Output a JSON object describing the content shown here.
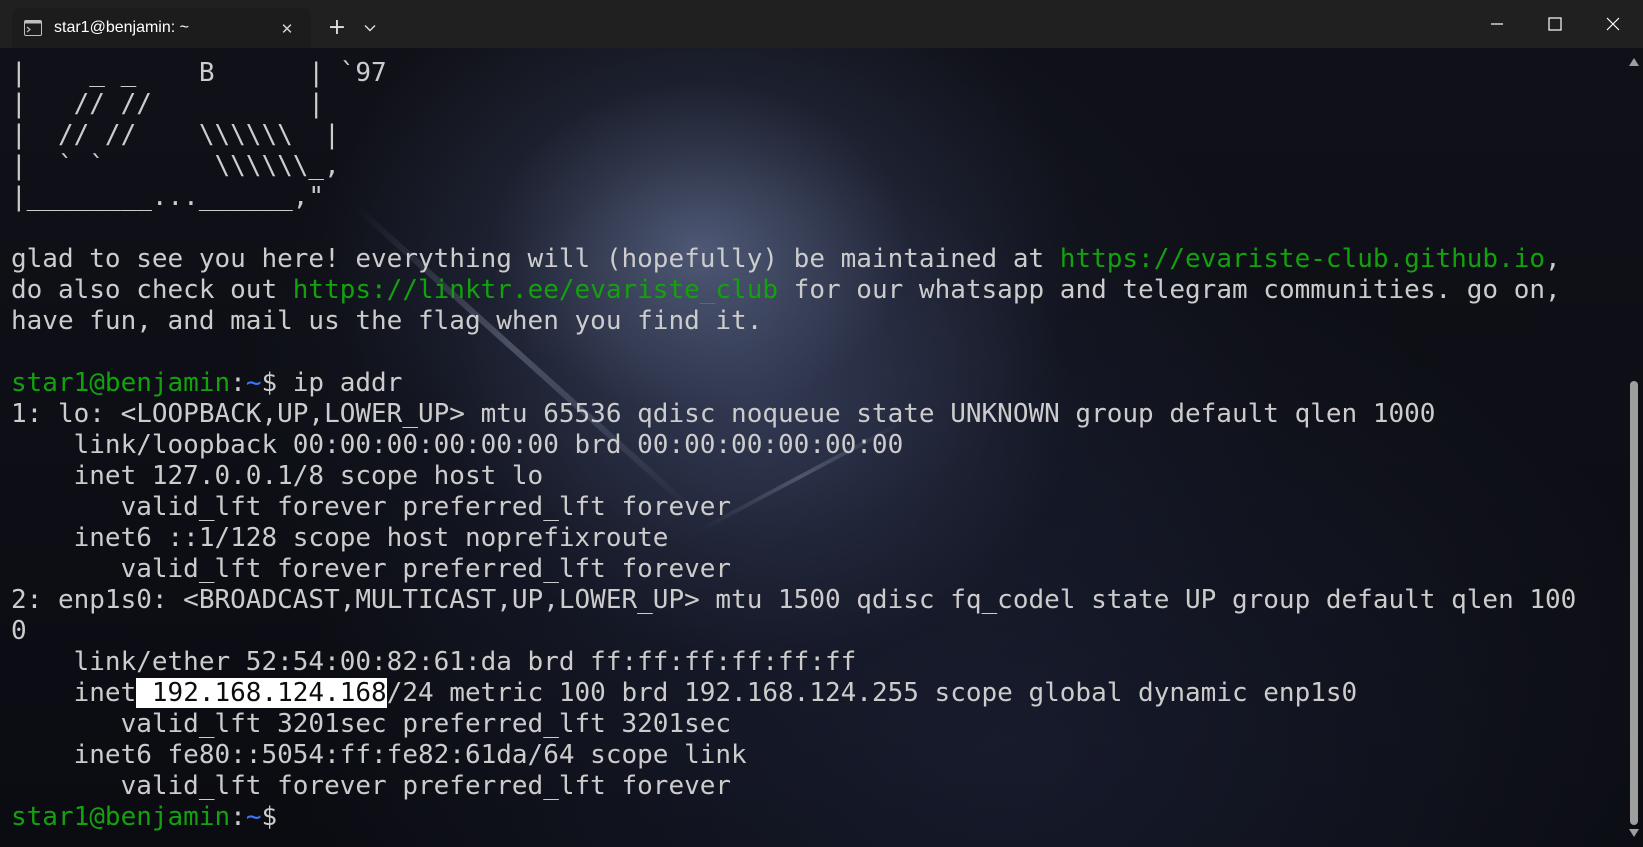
{
  "colors": {
    "prompt_user": "#13a10e",
    "prompt_path": "#3b78ff",
    "text": "#cccccc",
    "link": "#13a10e",
    "selection_bg": "#ffffff",
    "titlebar_bg": "#202020",
    "terminal_bg": "#0c0c0c"
  },
  "icons": {
    "tab": "terminal-icon",
    "close_tab": "close-icon",
    "new_tab": "plus-icon",
    "tab_menu": "chevron-down-icon",
    "minimize": "minimize-icon",
    "maximize": "maximize-icon",
    "close_window": "close-window-icon"
  },
  "tab": {
    "title": "star1@benjamin: ~",
    "close_glyph": "✕",
    "new_tab_glyph": "+"
  },
  "terminal": {
    "ascii_art": [
      "|    _ _    B      | `97",
      "|   // //          |",
      "|  // //    \\\\\\\\\\\\  |",
      "|  ` `       \\\\\\\\\\\\_,",
      "|________...______,\""
    ],
    "motd": {
      "line1_text": "glad to see you here! everything will (hopefully) be maintained at ",
      "line1_link": "https://evariste-club.github.io",
      "line1_tail": ",",
      "line2_text": "do also check out ",
      "line2_link": "https://linktr.ee/evariste_club",
      "line2_tail": " for our whatsapp and telegram communities. go on,",
      "line3_text": "have fun, and mail us the flag when you find it."
    },
    "prompt": {
      "user_host": "star1@benjamin",
      "colon": ":",
      "path": "~",
      "symbol": "$"
    },
    "command": " ip addr",
    "output": {
      "l1": "1: lo: <LOOPBACK,UP,LOWER_UP> mtu 65536 qdisc noqueue state UNKNOWN group default qlen 1000",
      "l2": "    link/loopback 00:00:00:00:00:00 brd 00:00:00:00:00:00",
      "l3": "    inet 127.0.0.1/8 scope host lo",
      "l4": "       valid_lft forever preferred_lft forever",
      "l5": "    inet6 ::1/128 scope host noprefixroute",
      "l6": "       valid_lft forever preferred_lft forever",
      "l7": "2: enp1s0: <BROADCAST,MULTICAST,UP,LOWER_UP> mtu 1500 qdisc fq_codel state UP group default qlen 100",
      "l8": "0",
      "l9": "    link/ether 52:54:00:82:61:da brd ff:ff:ff:ff:ff:ff",
      "l10_pre": "    inet",
      "l10_sel": " 192.168.124.168",
      "l10_post": "/24 metric 100 brd 192.168.124.255 scope global dynamic enp1s0",
      "l11": "       valid_lft 3201sec preferred_lft 3201sec",
      "l12": "    inet6 fe80::5054:ff:fe82:61da/64 scope link",
      "l13": "       valid_lft forever preferred_lft forever"
    }
  }
}
